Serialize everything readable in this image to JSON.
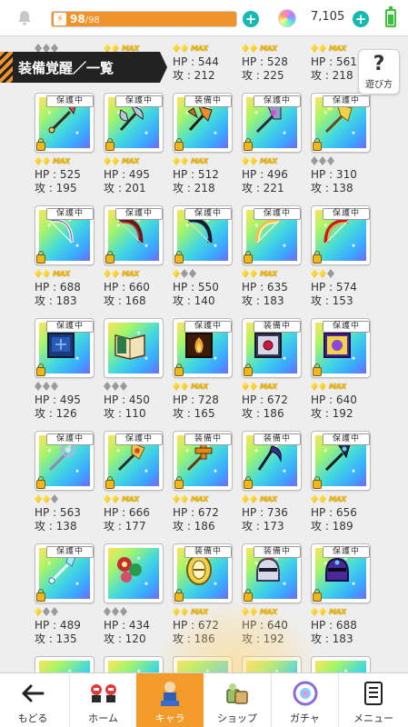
{
  "topbar": {
    "stamina_current": "98",
    "stamina_max": "/98",
    "stamina_fraction": 1.0,
    "gem_count": "7,105"
  },
  "section": {
    "title": "装備覚醒／一覧",
    "help_label": "遊び方",
    "help_glyph": "?"
  },
  "guard_label": "保護中",
  "equip_label": "装備中",
  "max_badge": "MAX",
  "colors": {
    "accent_orange": "#f29a2a",
    "teal_button": "#16b8b0",
    "header_dark": "#222222"
  },
  "top_partial": [
    {
      "stars": 0,
      "max": false,
      "hp": "",
      "atk": ""
    },
    {
      "stars": 2,
      "max": true,
      "hp": "",
      "atk": ""
    },
    {
      "stars": 2,
      "max": true,
      "hp": "HP : 544",
      "atk": "攻 : 212"
    },
    {
      "stars": 2,
      "max": true,
      "hp": "HP : 528",
      "atk": "攻 : 225"
    },
    {
      "stars": 2,
      "max": true,
      "hp": "HP : 561",
      "atk": "攻 : 218"
    }
  ],
  "rows": [
    [
      {
        "tag": "guard",
        "icon": "spear-icon",
        "stars": 2,
        "max": true,
        "hp": "HP : 525",
        "atk": "攻 : 195"
      },
      {
        "tag": "guard",
        "icon": "axe-icon",
        "stars": 2,
        "max": true,
        "hp": "HP : 495",
        "atk": "攻 : 201"
      },
      {
        "tag": "equip",
        "icon": "halberd-icon",
        "stars": 2,
        "max": true,
        "hp": "HP : 512",
        "atk": "攻 : 218"
      },
      {
        "tag": "guard",
        "icon": "battle-axe-icon",
        "stars": 2,
        "max": true,
        "hp": "HP : 496",
        "atk": "攻 : 221"
      },
      {
        "tag": "guard",
        "icon": "golden-axe-icon",
        "stars": 0,
        "max": false,
        "hp": "HP : 310",
        "atk": "攻 : 138"
      }
    ],
    [
      {
        "tag": "guard",
        "icon": "silver-bow-icon",
        "stars": 2,
        "max": true,
        "hp": "HP : 688",
        "atk": "攻 : 183"
      },
      {
        "tag": "guard",
        "icon": "dark-bow-icon",
        "stars": 2,
        "max": true,
        "hp": "HP : 660",
        "atk": "攻 : 168"
      },
      {
        "tag": "guard",
        "icon": "black-bow-icon",
        "stars": 1,
        "max": false,
        "hp": "HP : 550",
        "atk": "攻 : 140"
      },
      {
        "tag": "guard",
        "icon": "gold-bow-icon",
        "stars": 2,
        "max": true,
        "hp": "HP : 635",
        "atk": "攻 : 183"
      },
      {
        "tag": "guard",
        "icon": "flame-bow-icon",
        "stars": 2,
        "max": false,
        "hp": "HP : 574",
        "atk": "攻 : 153"
      }
    ],
    [
      {
        "tag": "guard",
        "icon": "blue-tome-icon",
        "stars": 0,
        "max": false,
        "hp": "HP : 495",
        "atk": "攻 : 126"
      },
      {
        "tag": "none",
        "icon": "open-book-icon",
        "stars": 0,
        "max": false,
        "hp": "HP : 450",
        "atk": "攻 : 110"
      },
      {
        "tag": "guard",
        "icon": "fire-tome-icon",
        "stars": 2,
        "max": true,
        "hp": "HP : 728",
        "atk": "攻 : 165"
      },
      {
        "tag": "equip",
        "icon": "red-gem-tome-icon",
        "stars": 2,
        "max": true,
        "hp": "HP : 672",
        "atk": "攻 : 186"
      },
      {
        "tag": "guard",
        "icon": "purple-tome-icon",
        "stars": 2,
        "max": true,
        "hp": "HP : 640",
        "atk": "攻 : 192"
      }
    ],
    [
      {
        "tag": "guard",
        "icon": "crystal-staff-icon",
        "stars": 2,
        "max": false,
        "hp": "HP : 563",
        "atk": "攻 : 138"
      },
      {
        "tag": "guard",
        "icon": "gold-staff-icon",
        "stars": 2,
        "max": true,
        "hp": "HP : 666",
        "atk": "攻 : 177"
      },
      {
        "tag": "equip",
        "icon": "cross-staff-icon",
        "stars": 2,
        "max": true,
        "hp": "HP : 672",
        "atk": "攻 : 186"
      },
      {
        "tag": "equip",
        "icon": "dark-scythe-icon",
        "stars": 2,
        "max": true,
        "hp": "HP : 736",
        "atk": "攻 : 173"
      },
      {
        "tag": "guard",
        "icon": "shadow-staff-icon",
        "stars": 2,
        "max": true,
        "hp": "HP : 656",
        "atk": "攻 : 189"
      }
    ],
    [
      {
        "tag": "guard",
        "icon": "ice-spear-icon",
        "stars": 1,
        "max": false,
        "hp": "HP : 489",
        "atk": "攻 : 135"
      },
      {
        "tag": "none",
        "icon": "flower-shield-icon",
        "stars": 0,
        "max": false,
        "hp": "HP : 434",
        "atk": "攻 : 120"
      },
      {
        "tag": "equip",
        "icon": "gold-shield-icon",
        "stars": 2,
        "max": true,
        "hp": "HP : 672",
        "atk": "攻 : 186"
      },
      {
        "tag": "equip",
        "icon": "knight-helm-icon",
        "stars": 2,
        "max": true,
        "hp": "HP : 640",
        "atk": "攻 : 192"
      },
      {
        "tag": "guard",
        "icon": "purple-helm-icon",
        "stars": 2,
        "max": true,
        "hp": "HP : 688",
        "atk": "攻 : 183"
      }
    ]
  ],
  "nav": {
    "back": "もどる",
    "home": "ホーム",
    "chara": "キャラ",
    "shop": "ショップ",
    "gacha": "ガチャ",
    "menu": "メニュー"
  }
}
